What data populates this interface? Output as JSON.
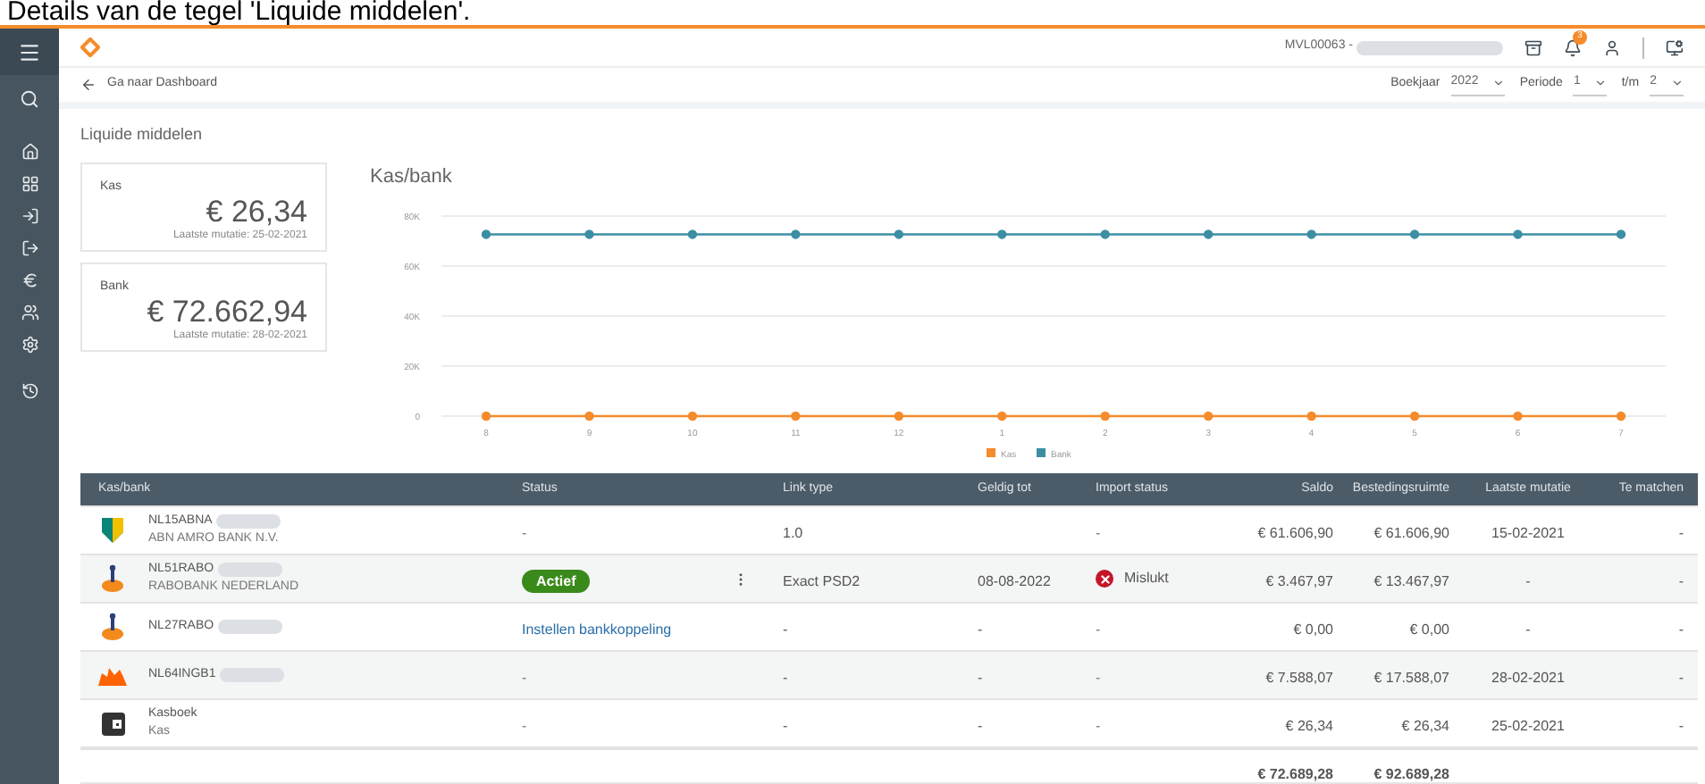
{
  "caption": "Details van de tegel 'Liquide middelen'.",
  "topbar": {
    "org": "MVL00063 -",
    "org_redacted": true,
    "notifications": "3"
  },
  "breadcrumb": "Ga naar Dashboard",
  "filters": [
    {
      "label": "Boekjaar",
      "value": "2022"
    },
    {
      "label": "Periode",
      "value": "1"
    },
    {
      "label": "t/m",
      "value": "2"
    }
  ],
  "section_title": "Liquide middelen",
  "cards": [
    {
      "label": "Kas",
      "amount": "€ 26,34",
      "note": "Laatste mutatie: 25-02-2021"
    },
    {
      "label": "Bank",
      "amount": "€ 72.662,94",
      "note": "Laatste mutatie: 28-02-2021"
    }
  ],
  "chart": {
    "title": "Kas/bank",
    "chart_data": {
      "type": "line",
      "categories": [
        "8",
        "9",
        "10",
        "11",
        "12",
        "1",
        "2",
        "3",
        "4",
        "5",
        "6",
        "7"
      ],
      "grid": true,
      "legend": true,
      "series": [
        {
          "name": "Kas",
          "color": "#f58b2b",
          "marker": true,
          "values": [
            0,
            0,
            0,
            0,
            0,
            0,
            0,
            0,
            0,
            0,
            0,
            0
          ]
        },
        {
          "name": "Bank",
          "color": "#3c8ea3",
          "marker": true,
          "values": [
            72700,
            72700,
            72700,
            72700,
            72700,
            72700,
            72700,
            72700,
            72700,
            72700,
            72700,
            72700
          ]
        }
      ],
      "ylim": [
        0,
        80000
      ],
      "yticks": [
        {
          "value": 0,
          "label": "0"
        },
        {
          "value": 20000,
          "label": "20K"
        },
        {
          "value": 40000,
          "label": "40K"
        },
        {
          "value": 60000,
          "label": "60K"
        },
        {
          "value": 80000,
          "label": "80K"
        }
      ]
    }
  },
  "table": {
    "columns": [
      "Kas/bank",
      "Status",
      "Link type",
      "Geldig tot",
      "Import status",
      "Saldo",
      "Bestedingsruimte",
      "Laatste mutatie",
      "Te matchen"
    ],
    "rows": [
      {
        "kind": "shield",
        "account": "NL15ABNA",
        "redacted": true,
        "bank": "ABN AMRO BANK N.V.",
        "status": {
          "kind": "plain",
          "text": "-"
        },
        "menu": false,
        "link_type": "1.0",
        "import": {
          "kind": "plain",
          "text": "-"
        },
        "saldo": "€ 61.606,90",
        "spend": "€ 61.606,90",
        "last": "15-02-2021",
        "match": "-"
      },
      {
        "kind": "figure",
        "account": "NL51RABO",
        "redacted": true,
        "bank": "RABOBANK NEDERLAND",
        "status": {
          "kind": "badge",
          "text": "Actief"
        },
        "menu": true,
        "link_type": "Exact PSD2",
        "valid_until": "08-08-2022",
        "import": {
          "kind": "failed",
          "text": "Mislukt"
        },
        "saldo": "€ 3.467,97",
        "spend": "€ 13.467,97",
        "last": "-",
        "match": "-"
      },
      {
        "kind": "figure",
        "account": "NL27RABO",
        "redacted": true,
        "status": {
          "kind": "link",
          "text": "Instellen bankkoppeling"
        },
        "menu": false,
        "link_type": "-",
        "valid_until": "-",
        "import": {
          "kind": "plain",
          "text": "-"
        },
        "saldo": "€ 0,00",
        "spend": "€ 0,00",
        "last": "-",
        "match": "-"
      },
      {
        "kind": "lion",
        "account": "NL64INGB1",
        "redacted": true,
        "status": {
          "kind": "plain",
          "text": "-"
        },
        "menu": false,
        "link_type": "-",
        "valid_until": "-",
        "import": {
          "kind": "plain",
          "text": "-"
        },
        "saldo": "€ 7.588,07",
        "spend": "€ 17.588,07",
        "last": "28-02-2021",
        "match": "-"
      },
      {
        "kind": "wallet",
        "account": "Kasboek",
        "redacted": false,
        "bank": "Kas",
        "status": {
          "kind": "plain",
          "text": "-"
        },
        "menu": false,
        "link_type": "-",
        "valid_until": "-",
        "import": {
          "kind": "plain",
          "text": "-"
        },
        "saldo": "€ 26,34",
        "spend": "€ 26,34",
        "last": "25-02-2021",
        "match": "-"
      }
    ],
    "totals": {
      "saldo": "€ 72.689,28",
      "spend": "€ 92.689,28"
    }
  }
}
